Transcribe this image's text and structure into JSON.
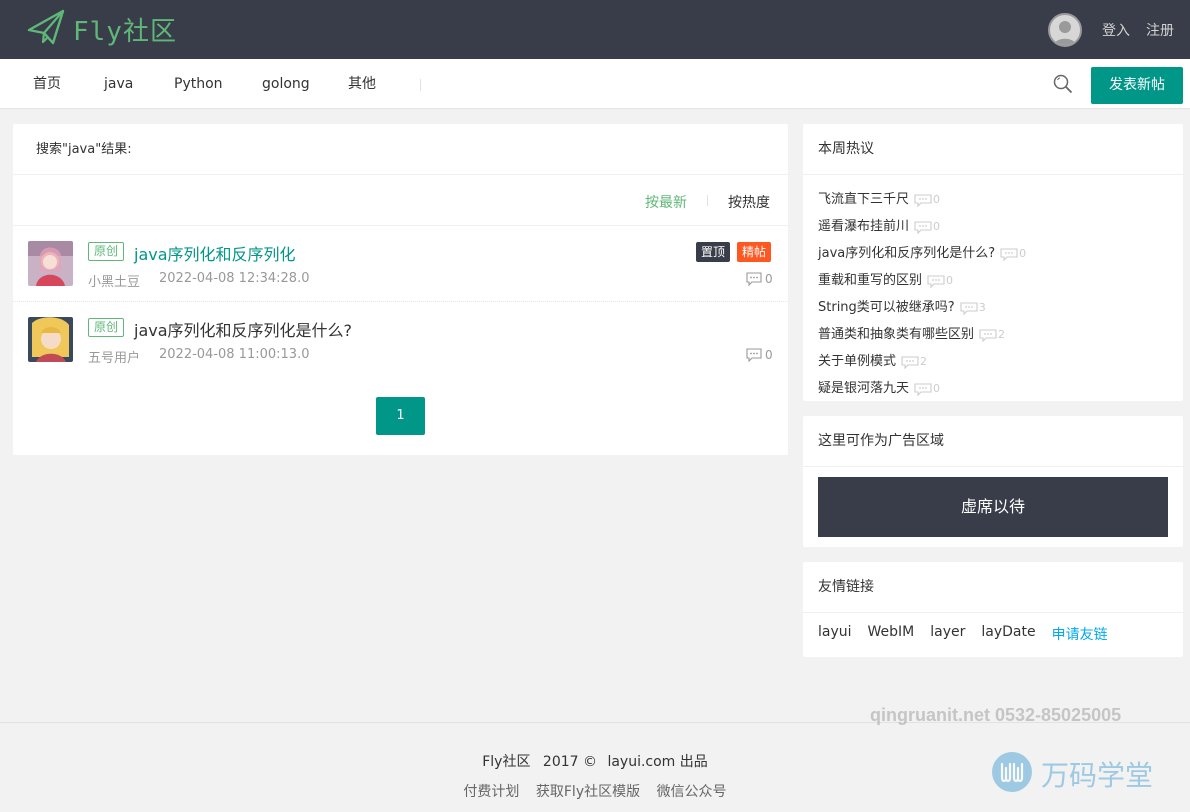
{
  "header": {
    "logo_text": "Fly社区",
    "login": "登入",
    "register": "注册"
  },
  "nav": {
    "items": [
      "首页",
      "java",
      "Python",
      "golong",
      "其他"
    ],
    "post_button": "发表新帖"
  },
  "search": {
    "result_title": "搜索\"java\"结果:",
    "sort_latest": "按最新",
    "sort_hot": "按热度"
  },
  "posts": [
    {
      "tag": "原创",
      "title": "java序列化和反序列化",
      "user": "小黑土豆",
      "date": "2022-04-08 12:34:28.0",
      "badge_top": "置顶",
      "badge_fine": "精帖",
      "replies": "0"
    },
    {
      "tag": "原创",
      "title": "java序列化和反序列化是什么?",
      "user": "五号用户",
      "date": "2022-04-08 11:00:13.0",
      "replies": "0"
    }
  ],
  "pagination": {
    "current": "1"
  },
  "hot": {
    "title": "本周热议",
    "items": [
      {
        "title": "飞流直下三千尺",
        "count": "0"
      },
      {
        "title": "遥看瀑布挂前川",
        "count": "0"
      },
      {
        "title": "java序列化和反序列化是什么?",
        "count": "0"
      },
      {
        "title": "重载和重写的区别",
        "count": "0"
      },
      {
        "title": "String类可以被继承吗?",
        "count": "3"
      },
      {
        "title": "普通类和抽象类有哪些区别",
        "count": "2"
      },
      {
        "title": "关于单例模式",
        "count": "2"
      },
      {
        "title": "疑是银河落九天",
        "count": "0"
      }
    ]
  },
  "ad": {
    "title": "这里可作为广告区域",
    "placeholder": "虚席以待"
  },
  "links": {
    "title": "友情链接",
    "items": [
      "layui",
      "WebIM",
      "layer",
      "layDate"
    ],
    "apply": "申请友链"
  },
  "footer": {
    "line1_brand": "Fly社区",
    "line1_year": "2017 ©",
    "line1_site": "layui.com 出品",
    "line2": [
      "付费计划",
      "获取Fly社区模版",
      "微信公众号"
    ]
  },
  "watermark": {
    "contact": "qingruanit.net 0532-85025005",
    "brand": "万码学堂"
  },
  "colors": {
    "header_bg": "#393d49",
    "accent": "#009688",
    "brand_green": "#5fb878",
    "badge_hot": "#ff5722",
    "link_blue": "#01aaed"
  }
}
